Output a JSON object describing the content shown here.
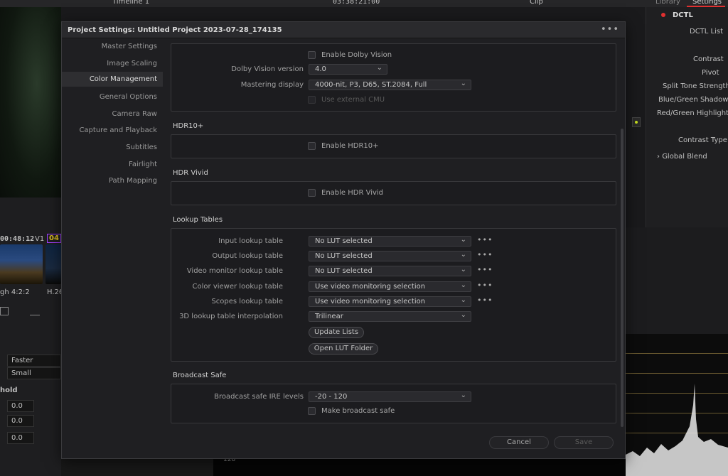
{
  "background": {
    "timecode_top": "03:38:21:00",
    "timeline_label": "Timeline 1",
    "clip_label": "Clip",
    "tab_library": "Library",
    "tab_settings": "Settings",
    "dctl_title": "DCTL",
    "dctl_list_label": "DCTL List",
    "contrast_label": "Contrast",
    "pivot_label": "Pivot",
    "split_tone_label": "Split Tone Strength",
    "blue_green_label": "Blue/Green Shadows",
    "red_green_label": "Red/Green Highlights",
    "contrast_type_label": "Contrast Type",
    "global_blend_label": "Global Blend",
    "clip_timecode": "00:48:12",
    "track_v1": "V1",
    "track_badge": "04",
    "clip_format_left": "gh 4:2:2",
    "clip_format_right": "H.26",
    "speed_value": "Faster",
    "size_value": "Small",
    "threshold_label": "hold",
    "value_1": "0.0",
    "value_2": "0.0",
    "value_3": "0.0",
    "scope_label": "128"
  },
  "dialog": {
    "title": "Project Settings:  Untitled Project 2023-07-28_174135",
    "menu": "•••",
    "nav": [
      {
        "label": "Master Settings"
      },
      {
        "label": "Image Scaling"
      },
      {
        "label": "Color Management"
      },
      {
        "label": "General Options"
      },
      {
        "label": "Camera Raw"
      },
      {
        "label": "Capture and Playback"
      },
      {
        "label": "Subtitles"
      },
      {
        "label": "Fairlight"
      },
      {
        "label": "Path Mapping"
      }
    ],
    "active_nav": "Color Management",
    "dolby": {
      "enable_label": "Enable Dolby Vision",
      "version_label": "Dolby Vision version",
      "version_value": "4.0",
      "mastering_label": "Mastering display",
      "mastering_value": "4000-nit, P3, D65, ST.2084, Full",
      "external_cmu_label": "Use external CMU"
    },
    "hdr10": {
      "title": "HDR10+",
      "enable_label": "Enable HDR10+"
    },
    "hdr_vivid": {
      "title": "HDR Vivid",
      "enable_label": "Enable HDR Vivid"
    },
    "lut": {
      "title": "Lookup Tables",
      "rows": [
        {
          "label": "Input lookup table",
          "value": "No LUT selected",
          "more": "•••"
        },
        {
          "label": "Output lookup table",
          "value": "No LUT selected",
          "more": "•••"
        },
        {
          "label": "Video monitor lookup table",
          "value": "No LUT selected",
          "more": "•••"
        },
        {
          "label": "Color viewer lookup table",
          "value": "Use video monitoring selection",
          "more": "•••"
        },
        {
          "label": "Scopes lookup table",
          "value": "Use video monitoring selection",
          "more": "•••"
        },
        {
          "label": "3D lookup table interpolation",
          "value": "Trilinear"
        }
      ],
      "update_button": "Update Lists",
      "open_folder_button": "Open LUT Folder"
    },
    "broadcast": {
      "title": "Broadcast Safe",
      "ire_label": "Broadcast safe IRE levels",
      "ire_value": "-20 - 120",
      "make_safe_label": "Make broadcast safe"
    },
    "footer": {
      "cancel": "Cancel",
      "save": "Save"
    }
  },
  "colors": {
    "accent_red": "#e03030",
    "badge_purple": "#a040ff",
    "badge_yellow": "#e0c020",
    "indicator_green": "#c8e020"
  }
}
